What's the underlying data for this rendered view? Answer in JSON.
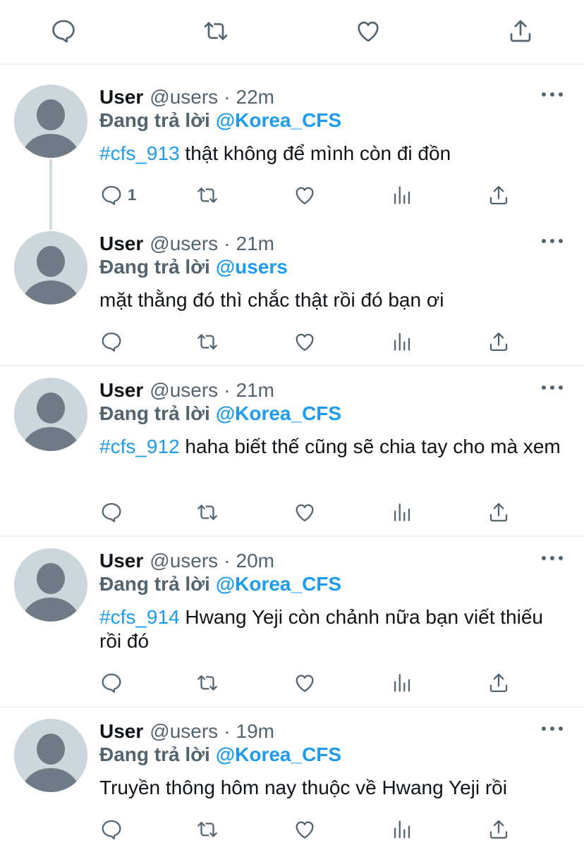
{
  "icons": {
    "reply": "reply-icon",
    "retweet": "retweet-icon",
    "like": "like-icon",
    "share": "share-icon",
    "analytics": "analytics-icon",
    "more": "more-icon"
  },
  "colors": {
    "link": "#1d9bf0",
    "muted": "#536471",
    "avatar_bg": "#ccd6dd",
    "avatar_fg": "#6e7a86"
  },
  "reply_prefix": "Đang trả lời",
  "tweets": [
    {
      "name": "User",
      "handle": "@users",
      "separator": "·",
      "time": "22m",
      "reply_to": "@Korea_CFS",
      "hashtag": "#cfs_913",
      "text": "thật không để mình còn đi đồn",
      "reply_count": "1"
    },
    {
      "name": "User",
      "handle": "@users",
      "separator": "·",
      "time": "21m",
      "reply_to": "@users",
      "hashtag": "",
      "text": "mặt thằng đó thì chắc thật rồi đó bạn ơi",
      "reply_count": ""
    },
    {
      "name": "User",
      "handle": "@users",
      "separator": "·",
      "time": "21m",
      "reply_to": "@Korea_CFS",
      "hashtag": "#cfs_912",
      "text": "haha biết thế cũng sẽ chia tay cho mà xem",
      "reply_count": ""
    },
    {
      "name": "User",
      "handle": "@users",
      "separator": "·",
      "time": "20m",
      "reply_to": "@Korea_CFS",
      "hashtag": "#cfs_914",
      "text": "Hwang Yeji còn chảnh nữa bạn viết thiếu rồi đó",
      "reply_count": ""
    },
    {
      "name": "User",
      "handle": "@users",
      "separator": "·",
      "time": "19m",
      "reply_to": "@Korea_CFS",
      "hashtag": "",
      "text": "Truyền thông hôm nay thuộc về Hwang Yeji rồi",
      "reply_count": ""
    }
  ]
}
